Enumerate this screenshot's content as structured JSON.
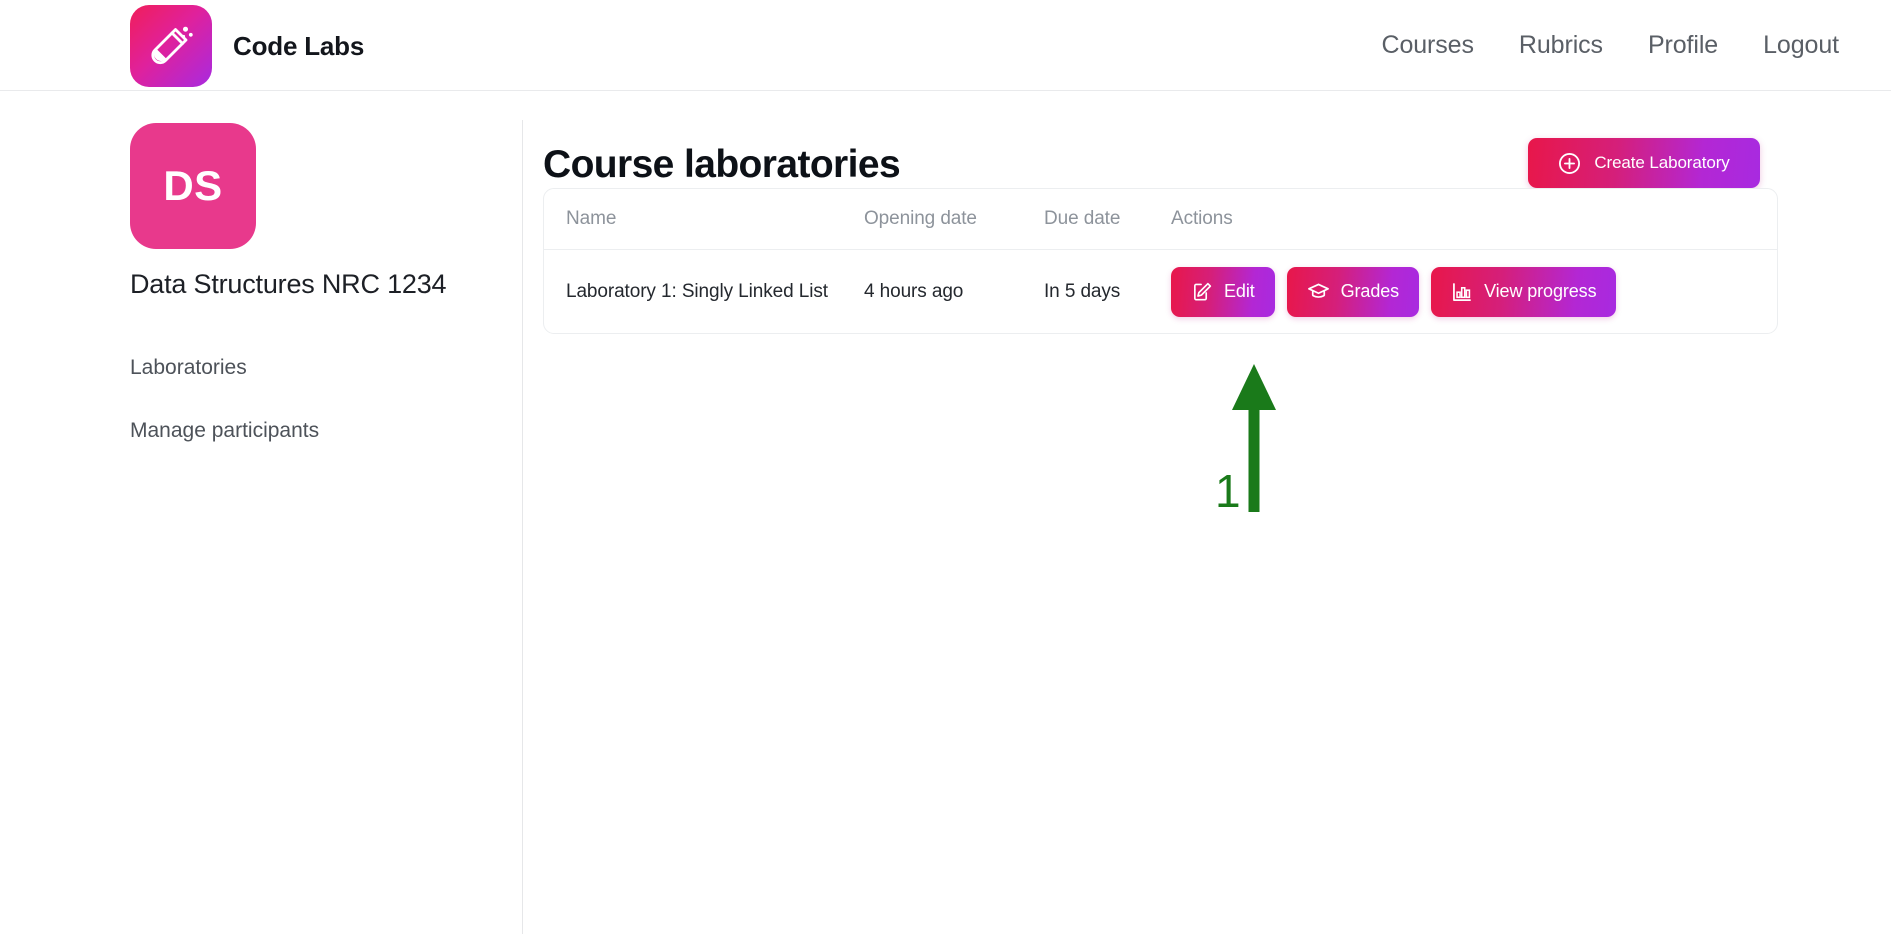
{
  "header": {
    "brand_name": "Code Labs",
    "logo_icon": "test-tube-icon",
    "nav": [
      {
        "label": "Courses"
      },
      {
        "label": "Rubrics"
      },
      {
        "label": "Profile"
      },
      {
        "label": "Logout"
      }
    ]
  },
  "sidebar": {
    "avatar_initials": "DS",
    "course_title": "Data Structures NRC 1234",
    "items": [
      {
        "label": "Laboratories"
      },
      {
        "label": "Manage participants"
      }
    ]
  },
  "main": {
    "page_title": "Course laboratories",
    "create_button": {
      "label": "Create Laboratory",
      "icon": "plus-circle-icon"
    },
    "table": {
      "columns": [
        "Name",
        "Opening date",
        "Due date",
        "Actions"
      ],
      "rows": [
        {
          "name": "Laboratory 1: Singly Linked List",
          "opening_date": "4 hours ago",
          "due_date": "In 5 days",
          "actions": [
            {
              "label": "Edit",
              "icon": "pencil-square-icon"
            },
            {
              "label": "Grades",
              "icon": "graduation-cap-icon"
            },
            {
              "label": "View progress",
              "icon": "bar-chart-icon"
            }
          ]
        }
      ]
    }
  },
  "annotation": {
    "step_number": "1",
    "arrow_color": "#1a7a1a",
    "points_at": "Edit"
  },
  "colors": {
    "gradient_start": "#e8174a",
    "gradient_end": "#a82ae0",
    "avatar_pink": "#e8398c",
    "text_dark": "#0d1117",
    "text_muted": "#8d939b",
    "border": "#eceef0"
  }
}
